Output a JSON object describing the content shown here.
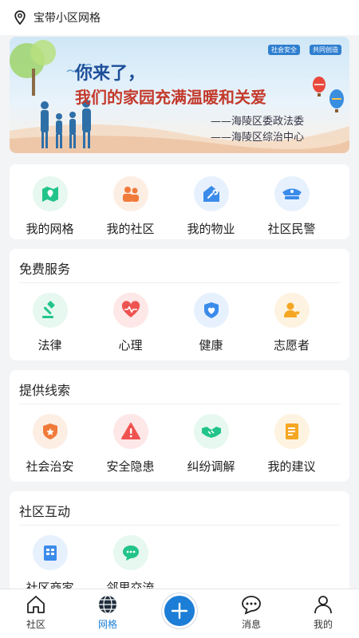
{
  "location": {
    "name": "宝带小区网格"
  },
  "banner": {
    "line1": "你来了，",
    "line2": "我们的家园充满温暖和关爱",
    "line3": "——海陵区委政法委",
    "line4": "——海陵区综治中心",
    "badges": [
      "社会安全",
      "共同创造"
    ]
  },
  "quick": [
    {
      "label": "我的网格",
      "icon": "map-grid-icon",
      "color": "#22c48a",
      "bg": "#e6f8f0"
    },
    {
      "label": "我的社区",
      "icon": "community-icon",
      "color": "#f07a3a",
      "bg": "#fdeee4"
    },
    {
      "label": "我的物业",
      "icon": "property-wrench-icon",
      "color": "#3b8bea",
      "bg": "#e7f1fd"
    },
    {
      "label": "社区民警",
      "icon": "police-cap-icon",
      "color": "#3b8bea",
      "bg": "#e7f1fd"
    }
  ],
  "free_services": {
    "title": "免费服务",
    "items": [
      {
        "label": "法律",
        "icon": "gavel-icon",
        "color": "#22c48a",
        "bg": "#e6f8f0"
      },
      {
        "label": "心理",
        "icon": "heart-pulse-icon",
        "color": "#ef5350",
        "bg": "#fde7e7"
      },
      {
        "label": "健康",
        "icon": "health-heart-icon",
        "color": "#3b8bea",
        "bg": "#e7f1fd"
      },
      {
        "label": "志愿者",
        "icon": "volunteer-icon",
        "color": "#f5a623",
        "bg": "#fdf3e0"
      }
    ]
  },
  "clues": {
    "title": "提供线索",
    "items": [
      {
        "label": "社会治安",
        "icon": "shield-star-icon",
        "color": "#f07a3a",
        "bg": "#fdeee4"
      },
      {
        "label": "安全隐患",
        "icon": "warning-icon",
        "color": "#ef5350",
        "bg": "#fde7e7"
      },
      {
        "label": "纠纷调解",
        "icon": "handshake-icon",
        "color": "#22c48a",
        "bg": "#e6f8f0"
      },
      {
        "label": "我的建议",
        "icon": "suggestion-note-icon",
        "color": "#f5a623",
        "bg": "#fdf3e0"
      }
    ]
  },
  "interaction": {
    "title": "社区互动",
    "items": [
      {
        "label": "社区商家",
        "icon": "merchant-icon",
        "color": "#3b8bea",
        "bg": "#e7f1fd"
      },
      {
        "label": "邻里交流",
        "icon": "chat-bubble-icon",
        "color": "#22c48a",
        "bg": "#e6f8f0"
      }
    ]
  },
  "tabbar": {
    "tabs": [
      {
        "label": "社区",
        "icon": "home-icon"
      },
      {
        "label": "网格",
        "icon": "globe-icon",
        "active": true
      },
      {
        "label": "",
        "icon": "plus-icon"
      },
      {
        "label": "消息",
        "icon": "message-icon"
      },
      {
        "label": "我的",
        "icon": "user-icon"
      }
    ]
  }
}
